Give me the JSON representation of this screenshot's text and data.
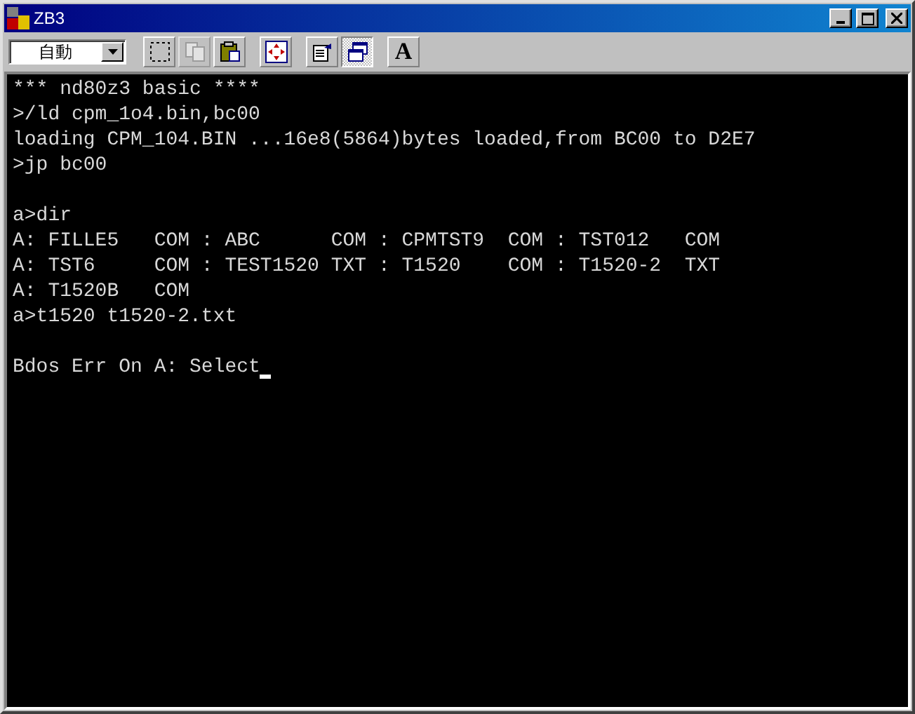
{
  "window": {
    "title": "ZB3"
  },
  "toolbar": {
    "mode": "自動",
    "buttons": [
      {
        "pressed": false,
        "disabled": false
      },
      {
        "pressed": false,
        "disabled": true
      },
      {
        "pressed": false,
        "disabled": false
      },
      {
        "pressed": false,
        "disabled": false
      },
      {
        "pressed": false,
        "disabled": false
      },
      {
        "pressed": true,
        "disabled": false
      },
      {
        "pressed": false,
        "disabled": false,
        "label": "A"
      }
    ]
  },
  "terminal": {
    "lines": [
      {
        "kind": "text",
        "text": "*** nd80z3 basic ****"
      },
      {
        "kind": "text",
        "text": ">/ld cpm_1o4.bin,bc00"
      },
      {
        "kind": "text",
        "text": "loading CPM_104.BIN ...16e8(5864)bytes loaded,from BC00 to D2E7"
      },
      {
        "kind": "text",
        "text": ">jp bc00"
      },
      {
        "kind": "blank"
      },
      {
        "kind": "text",
        "text": "a>dir"
      },
      {
        "kind": "text",
        "text": "A: FILLE5   COM : ABC      COM : CPMTST9  COM : TST012   COM"
      },
      {
        "kind": "text",
        "text": "A: TST6     COM : TEST1520 TXT : T1520    COM : T1520-2  TXT"
      },
      {
        "kind": "text",
        "text": "A: T1520B   COM"
      },
      {
        "kind": "text",
        "text": "a>t1520 t1520-2.txt"
      },
      {
        "kind": "blank"
      },
      {
        "kind": "text",
        "text": "Bdos Err On A: Select"
      }
    ],
    "cursor_visible": true
  }
}
